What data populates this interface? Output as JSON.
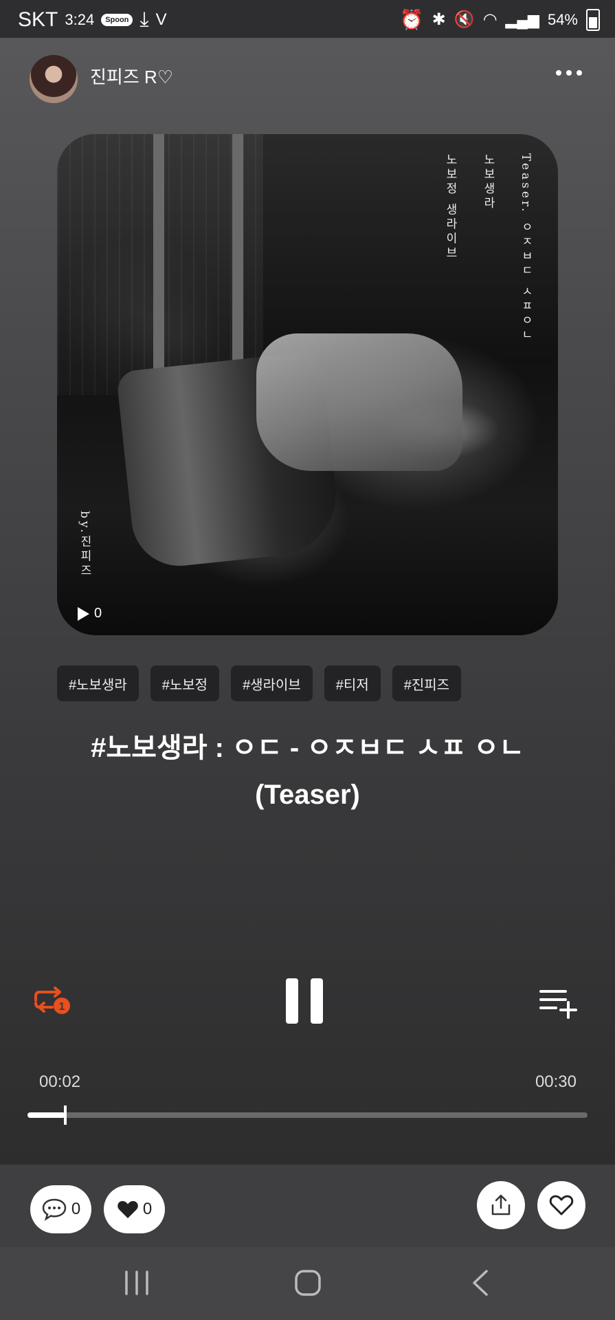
{
  "status_bar": {
    "carrier": "SKT",
    "time": "3:24",
    "app_pill": "Spoon",
    "battery": "54%"
  },
  "header": {
    "username": "진피즈 R♡"
  },
  "album": {
    "vertical_lines": [
      "Teaser. ㅇㅈㅂㄷ ㅅㅍㅇㄴ",
      "노보생라",
      "노보정 생라이브"
    ],
    "byline": "by.진피즈",
    "play_count": "0"
  },
  "tags": [
    "#노보생라",
    "#노보정",
    "#생라이브",
    "#티저",
    "#진피즈"
  ],
  "title": {
    "line1": "#노보생라 : ㅇㄷ - ㅇㅈㅂㄷ ㅅㅍ ㅇㄴ",
    "line2": "(Teaser)"
  },
  "player": {
    "current_time": "00:02",
    "total_time": "00:30",
    "progress": 0.067,
    "accent_color": "#e8501e",
    "repeat_badge": "1"
  },
  "actions": {
    "comment_count": "0",
    "like_count": "0"
  }
}
